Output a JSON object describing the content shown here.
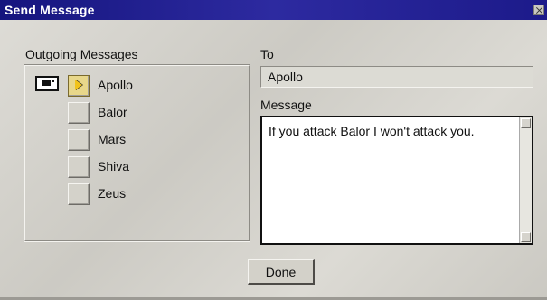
{
  "window": {
    "title": "Send Message",
    "close_icon": "close-icon"
  },
  "outgoing": {
    "label": "Outgoing Messages",
    "mail_icon": "envelope-icon",
    "recipients": [
      {
        "name": "Apollo",
        "selected": true
      },
      {
        "name": "Balor",
        "selected": false
      },
      {
        "name": "Mars",
        "selected": false
      },
      {
        "name": "Shiva",
        "selected": false
      },
      {
        "name": "Zeus",
        "selected": false
      }
    ]
  },
  "to": {
    "label": "To",
    "value": "Apollo"
  },
  "message": {
    "label": "Message",
    "value": "If you attack Balor I won't attack you."
  },
  "actions": {
    "done_label": "Done"
  },
  "colors": {
    "titlebar": "#1c1a8a",
    "selected_checkbox": "#e8d78a",
    "pointer": "#f1c31c"
  }
}
